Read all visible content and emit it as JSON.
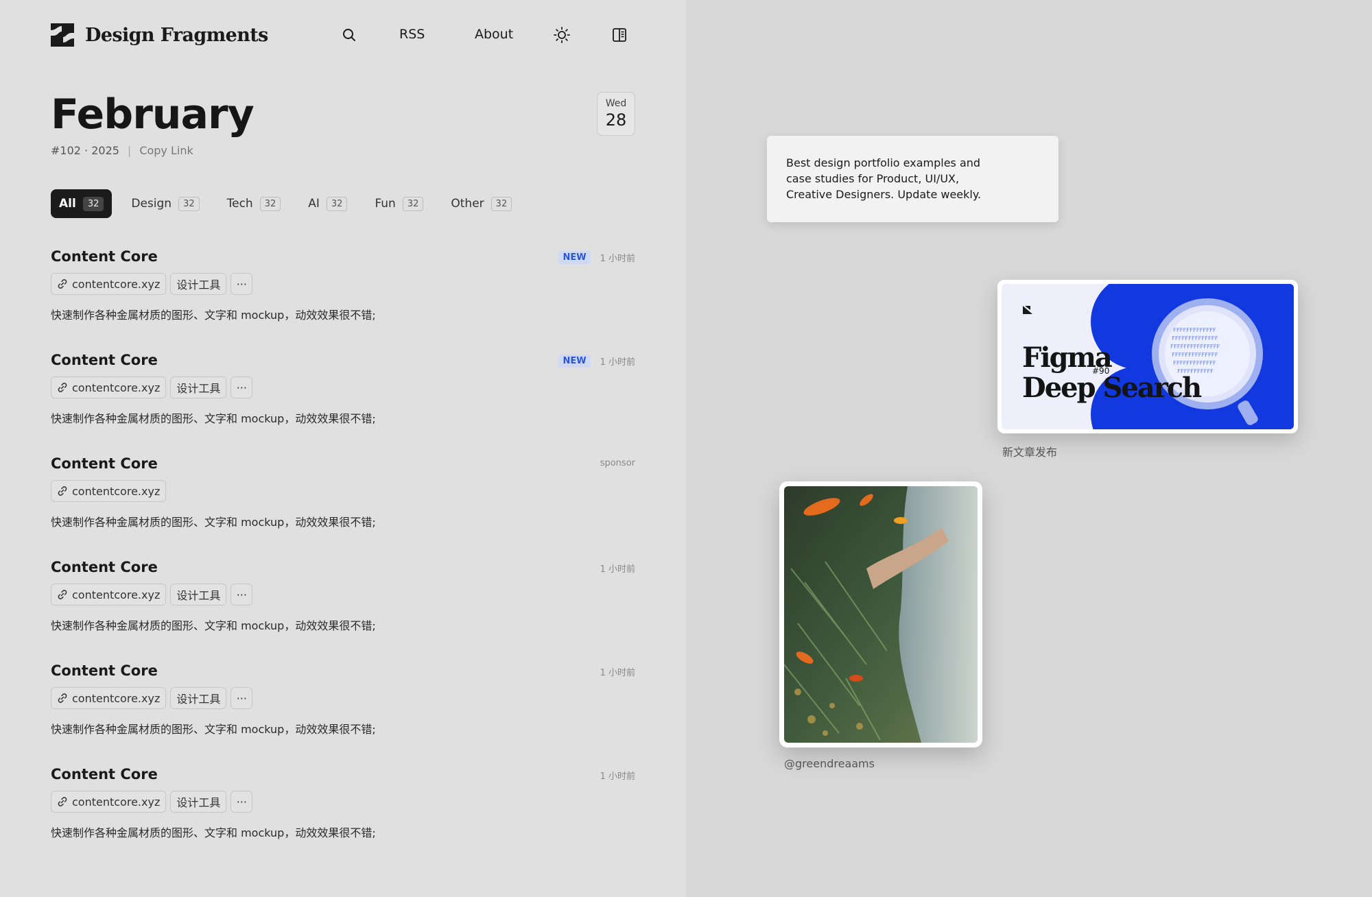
{
  "header": {
    "brand": "Design Fragments",
    "nav": {
      "search_icon": "search-icon",
      "rss": "RSS",
      "about": "About",
      "theme_icon": "sun-icon",
      "layout_icon": "sidebar-icon"
    }
  },
  "issue": {
    "month": "February",
    "number": "#102 · 2025",
    "separator": "|",
    "copy_link": "Copy Link",
    "weekday": "Wed",
    "day": "28"
  },
  "tabs": [
    {
      "label": "All",
      "count": "32",
      "active": true
    },
    {
      "label": "Design",
      "count": "32"
    },
    {
      "label": "Tech",
      "count": "32"
    },
    {
      "label": "AI",
      "count": "32"
    },
    {
      "label": "Fun",
      "count": "32"
    },
    {
      "label": "Other",
      "count": "32"
    }
  ],
  "items": [
    {
      "title": "Content Core",
      "badge": "NEW",
      "time": "1 小时前",
      "link": "contentcore.xyz",
      "tag": "设计工具",
      "more": "···",
      "desc": "快速制作各种金属材质的图形、文字和 mockup，动效效果很不错;"
    },
    {
      "title": "Content Core",
      "badge": "NEW",
      "time": "1 小时前",
      "link": "contentcore.xyz",
      "tag": "设计工具",
      "more": "···",
      "desc": "快速制作各种金属材质的图形、文字和 mockup，动效效果很不错;"
    },
    {
      "title": "Content Core",
      "time": "sponsor",
      "link": "contentcore.xyz",
      "desc": "快速制作各种金属材质的图形、文字和 mockup，动效效果很不错;"
    },
    {
      "title": "Content Core",
      "time": "1 小时前",
      "link": "contentcore.xyz",
      "tag": "设计工具",
      "more": "···",
      "desc": "快速制作各种金属材质的图形、文字和 mockup，动效效果很不错;"
    },
    {
      "title": "Content Core",
      "time": "1 小时前",
      "link": "contentcore.xyz",
      "tag": "设计工具",
      "more": "···",
      "desc": "快速制作各种金属材质的图形、文字和 mockup，动效效果很不错;"
    },
    {
      "title": "Content Core",
      "time": "1 小时前",
      "link": "contentcore.xyz",
      "tag": "设计工具",
      "more": "···",
      "desc": "快速制作各种金属材质的图形、文字和 mockup，动效效果很不错;"
    }
  ],
  "tooltip": {
    "text": "Best design portfolio examples and case studies for Product, UI/UX, Creative Designers. Update weekly."
  },
  "figma_card": {
    "title_line1": "Figma",
    "title_line2": "Deep Search",
    "number": "#90",
    "caption": "新文章发布"
  },
  "photo_card": {
    "caption": "@greendreaams"
  },
  "colors": {
    "accent_blue": "#1238e0",
    "badge_blue": "#2a55d6",
    "active_tab": "#1c1c1c"
  }
}
